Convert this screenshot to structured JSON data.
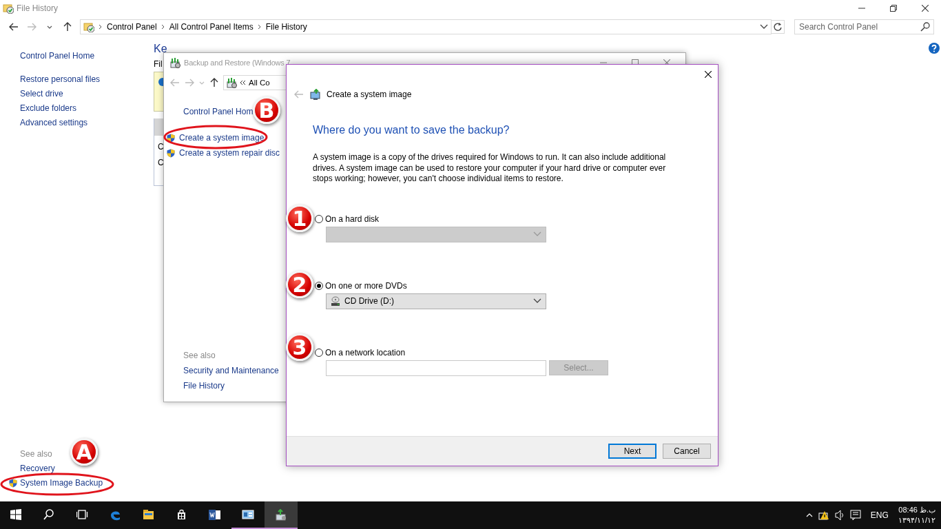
{
  "window": {
    "title": "File History",
    "breadcrumb": [
      "Control Panel",
      "All Control Panel Items",
      "File History"
    ],
    "search": {
      "placeholder": "Search Control Panel"
    }
  },
  "sidebar": {
    "items": [
      "Control Panel Home",
      "Restore personal files",
      "Select drive",
      "Exclude folders",
      "Advanced settings"
    ],
    "see_also_heading": "See also",
    "see_also": [
      {
        "label": "Recovery",
        "shield": false
      },
      {
        "label": "System Image Backup",
        "shield": true
      }
    ]
  },
  "content": {
    "heading": "Ke",
    "subtitle": "Fil",
    "rows": [
      "C",
      "C"
    ]
  },
  "backup_window": {
    "title": "Backup and Restore (Windows 7",
    "address": "All Co",
    "nav": [
      {
        "label": "Control Panel Hom",
        "shield": false
      },
      {
        "label": "Create a system image",
        "shield": true
      },
      {
        "label": "Create a system repair disc",
        "shield": true
      }
    ],
    "see_also_heading": "See also",
    "see_also": [
      "Security and Maintenance",
      "File History"
    ]
  },
  "dialog": {
    "title": "Create a system image",
    "heading": "Where do you want to save the backup?",
    "description": "A system image is a copy of the drives required for Windows to run. It can also include additional drives. A system image can be used to restore your computer if your hard drive or computer ever stops working; however, you can't choose individual items to restore.",
    "options": [
      {
        "label": "On a hard disk",
        "selected": false,
        "kind": "dropdown",
        "disabled": true
      },
      {
        "label": "On one or more DVDs",
        "selected": true,
        "kind": "dropdown",
        "disabled": false,
        "value": "CD Drive (D:)"
      },
      {
        "label": "On a network location",
        "selected": false,
        "kind": "path",
        "disabled": true,
        "button": "Select..."
      }
    ],
    "buttons": [
      {
        "label": "Next",
        "default": true
      },
      {
        "label": "Cancel",
        "default": false
      }
    ]
  },
  "annotations": [
    {
      "label": "A",
      "ellipse": true
    },
    {
      "label": "B",
      "ellipse": true
    },
    {
      "label": "1",
      "ellipse": false
    },
    {
      "label": "2",
      "ellipse": false
    },
    {
      "label": "3",
      "ellipse": false
    }
  ],
  "taskbar": {
    "apps": [
      {
        "kind": "start",
        "running": false,
        "active": false
      },
      {
        "kind": "search",
        "running": false,
        "active": false
      },
      {
        "kind": "taskview",
        "running": false,
        "active": false
      },
      {
        "kind": "edge",
        "running": false,
        "active": false
      },
      {
        "kind": "explorer",
        "running": false,
        "active": false
      },
      {
        "kind": "store",
        "running": false,
        "active": false
      },
      {
        "kind": "word",
        "running": false,
        "active": false
      },
      {
        "kind": "controlpanel",
        "running": true,
        "active": false
      },
      {
        "kind": "backup",
        "running": true,
        "active": true
      }
    ],
    "language": "ENG",
    "time": "08:46 ب.ظ",
    "date": "۱۳۹۴/۱۱/۱۲"
  }
}
